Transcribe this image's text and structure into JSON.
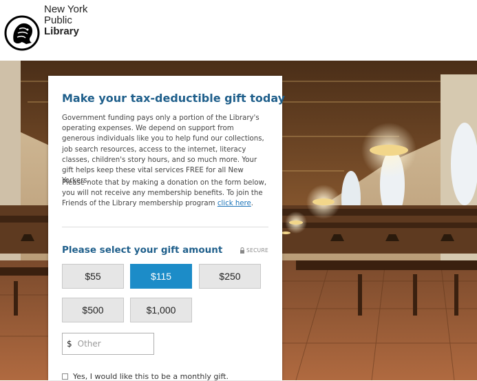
{
  "header": {
    "logo_line1": "New York",
    "logo_line2": "Public",
    "logo_line3": "Library"
  },
  "card": {
    "title": "Make your tax-deductible gift today",
    "paragraph1": "Government funding pays only a portion of the Library's operating expenses. We depend on support from generous individuals like you to help fund our collections, job search resources, access to the internet, literacy classes, children's story hours, and so much more. Your gift helps keep these vital services FREE for all New Yorkers.",
    "paragraph2_text": "Please note that by making a donation on the form below, you will not receive any membership benefits. To join the Friends of the Library membership program",
    "paragraph2_link": "click here",
    "paragraph2_end": ".",
    "select_heading": "Please select your gift amount",
    "secure_label": "SECURE",
    "amounts": [
      {
        "label": "$55",
        "selected": false
      },
      {
        "label": "$115",
        "selected": true
      },
      {
        "label": "$250",
        "selected": false
      },
      {
        "label": "$500",
        "selected": false
      },
      {
        "label": "$1,000",
        "selected": false
      }
    ],
    "other": {
      "currency": "$",
      "placeholder": "Other",
      "value": ""
    },
    "monthly_label": "Yes, I would like this to be a monthly gift."
  },
  "colors": {
    "accent": "#1f5f8b",
    "selected_button": "#1c8cc8",
    "link": "#1a73b8"
  }
}
